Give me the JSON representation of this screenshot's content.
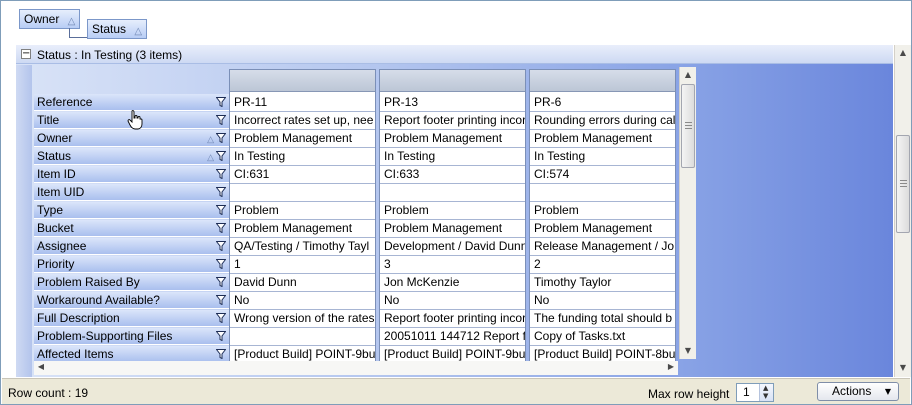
{
  "group_by": {
    "chips": [
      {
        "label": "Owner"
      },
      {
        "label": "Status"
      }
    ]
  },
  "group": {
    "title": "Status : In Testing (3 items)",
    "expander_symbol": "−"
  },
  "fields": [
    {
      "label": "Reference",
      "sorted": false
    },
    {
      "label": "Title",
      "sorted": false
    },
    {
      "label": "Owner",
      "sorted": true
    },
    {
      "label": "Status",
      "sorted": true
    },
    {
      "label": "Item ID",
      "sorted": false
    },
    {
      "label": "Item UID",
      "sorted": false
    },
    {
      "label": "Type",
      "sorted": false
    },
    {
      "label": "Bucket",
      "sorted": false
    },
    {
      "label": "Assignee",
      "sorted": false
    },
    {
      "label": "Priority",
      "sorted": false
    },
    {
      "label": "Problem Raised By",
      "sorted": false
    },
    {
      "label": "Workaround Available?",
      "sorted": false
    },
    {
      "label": "Full Description",
      "sorted": false
    },
    {
      "label": "Problem-Supporting Files",
      "sorted": false
    },
    {
      "label": "Affected Items",
      "sorted": false
    }
  ],
  "records": [
    {
      "values": [
        "PR-11",
        "Incorrect rates set up, nee",
        "Problem Management",
        "In Testing",
        "CI:631",
        "",
        "Problem",
        "Problem Management",
        "QA/Testing / Timothy Tayl",
        "1",
        "David Dunn",
        "No",
        "Wrong version of the rates",
        "",
        "[Product Build] POINT-9bu"
      ]
    },
    {
      "values": [
        "PR-13",
        "Report footer printing incor",
        "Problem Management",
        "In Testing",
        "CI:633",
        "",
        "Problem",
        "Problem Management",
        "Development / David Dunn",
        "3",
        "Jon McKenzie",
        "No",
        "Report footer printing incor",
        "20051011 144712 Report f",
        "[Product Build] POINT-9bu"
      ]
    },
    {
      "values": [
        "PR-6",
        "Rounding errors during cal",
        "Problem Management",
        "In Testing",
        "CI:574",
        "",
        "Problem",
        "Problem Management",
        "Release Management / Jo",
        "2",
        "Timothy Taylor",
        "No",
        "The funding total should b",
        "Copy of Tasks.txt",
        "[Product Build] POINT-8bu"
      ]
    }
  ],
  "footer": {
    "row_count": "Row count : 19",
    "max_row_height_label": "Max row height",
    "max_row_height_value": "1",
    "actions_label": "Actions"
  },
  "colors": {
    "accent": "#6a86dc",
    "row_header": "#a9bfee"
  }
}
